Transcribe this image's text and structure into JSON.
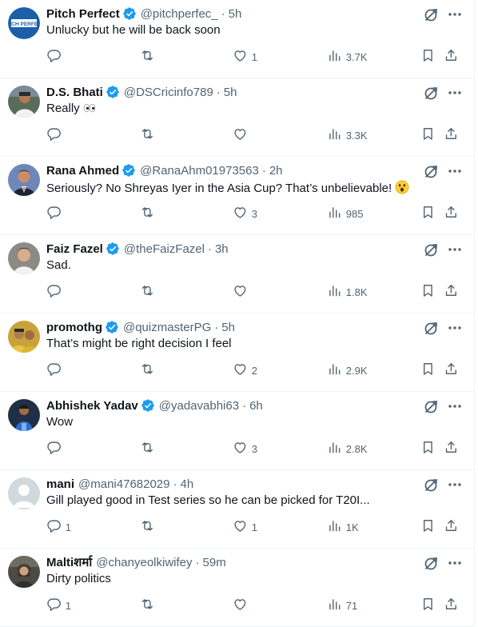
{
  "colors": {
    "accent": "#1d9bf0",
    "text": "#0f1419",
    "secondary": "#536471",
    "border": "#eff3f4"
  },
  "replies": [
    {
      "name": "Pitch Perfect",
      "verified": true,
      "handle": "@pitchperfec_",
      "time": "5h",
      "text": "Unlucky but he will be back soon",
      "replies": "",
      "likes": "1",
      "views": "3.7K",
      "avatar": "pitch-perfect-logo"
    },
    {
      "name": "D.S. Bhati",
      "verified": true,
      "handle": "@DSCricinfo789",
      "time": "5h",
      "text": "Really",
      "emoji": "eyes",
      "replies": "",
      "likes": "",
      "views": "3.3K",
      "avatar": "photo"
    },
    {
      "name": "Rana Ahmed",
      "verified": true,
      "handle": "@RanaAhm01973563",
      "time": "2h",
      "text": "Seriously? No Shreyas Iyer in the Asia Cup? That’s unbelievable!",
      "emoji": "astonished",
      "replies": "",
      "likes": "3",
      "views": "985",
      "avatar": "photo"
    },
    {
      "name": "Faiz Fazel",
      "verified": true,
      "handle": "@theFaizFazel",
      "time": "3h",
      "text": "Sad.",
      "replies": "",
      "likes": "",
      "views": "1.8K",
      "avatar": "photo"
    },
    {
      "name": "promothg",
      "verified": true,
      "handle": "@quizmasterPG",
      "time": "5h",
      "text": "That’s might be right decision I feel",
      "replies": "",
      "likes": "2",
      "views": "2.9K",
      "avatar": "photo"
    },
    {
      "name": "Abhishek Yadav",
      "verified": true,
      "handle": "@yadavabhi63",
      "time": "6h",
      "text": "Wow",
      "replies": "",
      "likes": "3",
      "views": "2.8K",
      "avatar": "photo"
    },
    {
      "name": "mani",
      "verified": false,
      "handle": "@mani47682029",
      "time": "4h",
      "text": "Gill played good in Test series so he can be picked for T20I...",
      "replies": "1",
      "likes": "1",
      "views": "1K",
      "avatar": "default"
    },
    {
      "name": "Maltiशर्मा",
      "verified": false,
      "handle": "@chanyeolkiwifey",
      "time": "59m",
      "text": "Dirty politics",
      "replies": "1",
      "likes": "",
      "views": "71",
      "avatar": "photo"
    }
  ]
}
